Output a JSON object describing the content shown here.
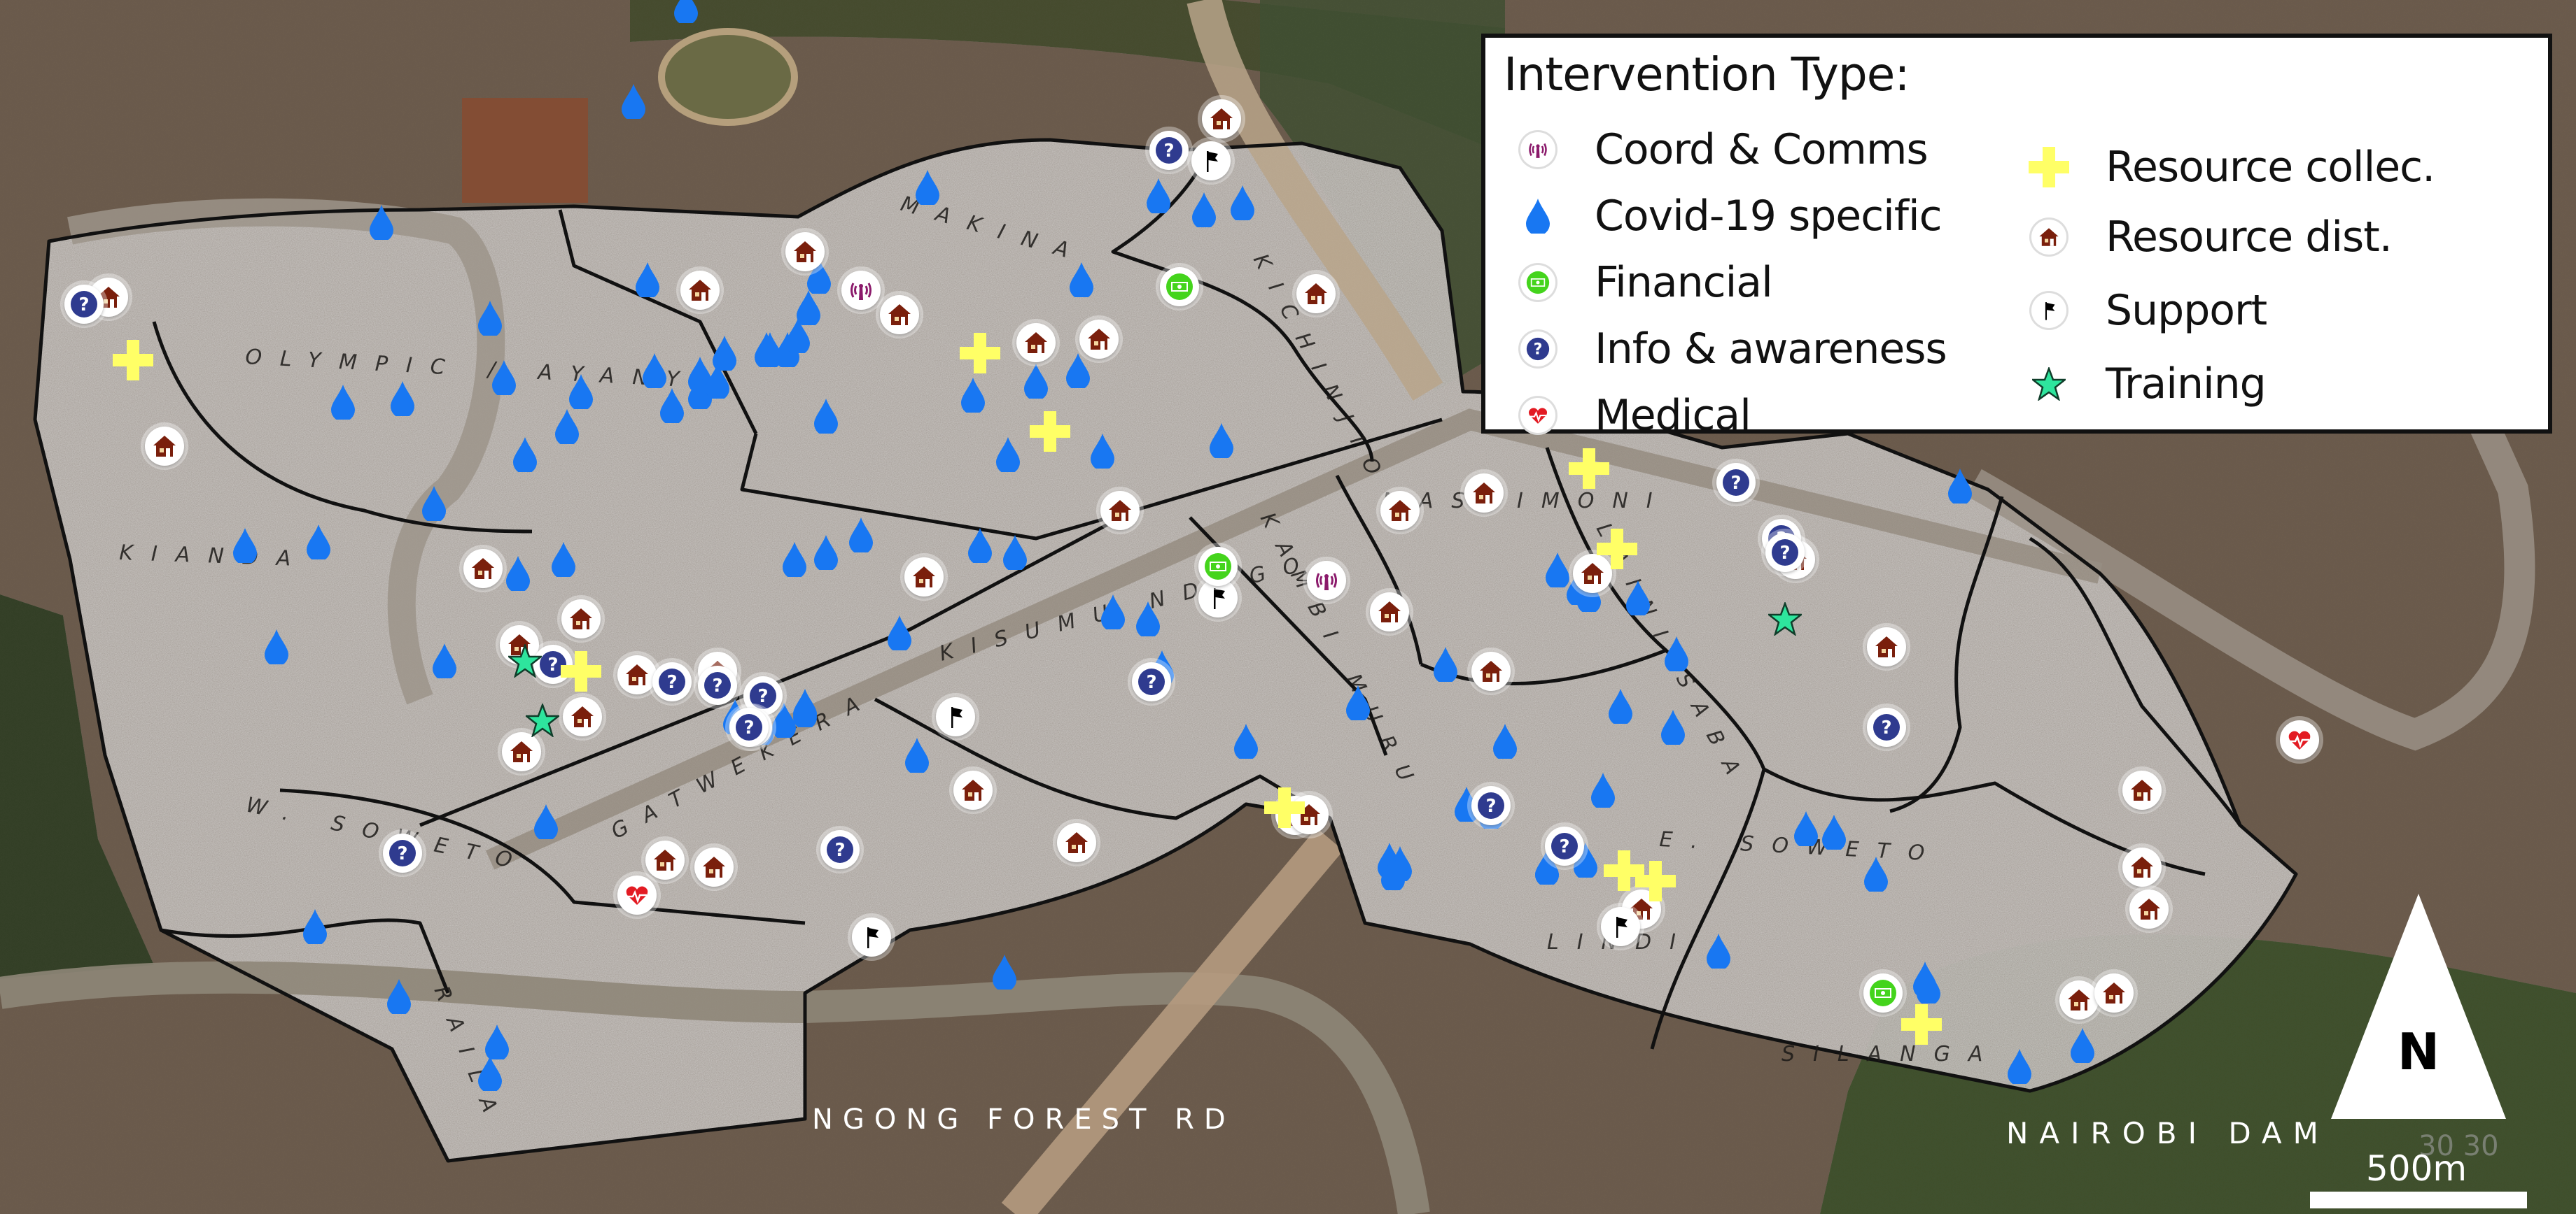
{
  "map": {
    "title": "Intervention Type:",
    "village_labels": [
      {
        "name": "olympic-ayany",
        "text": "OLYMPIC / AYANY"
      },
      {
        "name": "kianda",
        "text": "KIANDA"
      },
      {
        "name": "makina",
        "text": "MAKINA"
      },
      {
        "name": "kichinjio",
        "text": "KICHINJIO"
      },
      {
        "name": "mashimoni",
        "text": "MASHIMONI"
      },
      {
        "name": "kambi-muru",
        "text": "KAMBI MURU"
      },
      {
        "name": "kisumu-ndogo",
        "text": "KISUMU NDOGO"
      },
      {
        "name": "gatwekera",
        "text": "GATWEKERA"
      },
      {
        "name": "w-soweto",
        "text": "W. SOWETO"
      },
      {
        "name": "raila",
        "text": "RAILA"
      },
      {
        "name": "laini-saba",
        "text": "LAINI SABA"
      },
      {
        "name": "lindi",
        "text": "LINDI"
      },
      {
        "name": "silanga",
        "text": "SILANGA"
      },
      {
        "name": "e-soweto",
        "text": "E. SOWETO"
      }
    ],
    "road_label": "NGONG FOREST RD",
    "place_label": "NAIROBI DAM",
    "north_label": "N",
    "scale_label": "500m",
    "faint_watermark": "30 30"
  },
  "legend": {
    "title": "Intervention Type:",
    "items": [
      {
        "key": "coord",
        "label": "Coord & Comms",
        "icon": "broadcast-tower-icon",
        "color": "#8b1a6b"
      },
      {
        "key": "covid",
        "label": "Covid-19 specific",
        "icon": "water-drop-icon",
        "color": "#1877f2"
      },
      {
        "key": "financial",
        "label": "Financial",
        "icon": "banknote-icon",
        "color": "#44d41c"
      },
      {
        "key": "info",
        "label": "Info & awareness",
        "icon": "question-mark-icon",
        "color": "#2f3b8f"
      },
      {
        "key": "medical",
        "label": "Medical",
        "icon": "heartbeat-icon",
        "color": "#e31b23"
      },
      {
        "key": "rcollect",
        "label": "Resource collec.",
        "icon": "plus-cross-icon",
        "color": "#ffff66"
      },
      {
        "key": "rdist",
        "label": "Resource dist.",
        "icon": "house-icon",
        "color": "#7a1f0c"
      },
      {
        "key": "support",
        "label": "Support",
        "icon": "flag-icon",
        "color": "#000000"
      },
      {
        "key": "training",
        "label": "Training",
        "icon": "star-icon",
        "color": "#2ee59d"
      }
    ]
  },
  "markers": {
    "covid": [
      [
        980,
        8
      ],
      [
        905,
        145
      ],
      [
        545,
        318
      ],
      [
        925,
        400
      ],
      [
        700,
        455
      ],
      [
        935,
        530
      ],
      [
        1000,
        535
      ],
      [
        1035,
        505
      ],
      [
        1100,
        500
      ],
      [
        1125,
        500
      ],
      [
        1140,
        480
      ],
      [
        1170,
        395
      ],
      [
        1155,
        440
      ],
      [
        1000,
        560
      ],
      [
        1025,
        545
      ],
      [
        490,
        575
      ],
      [
        720,
        540
      ],
      [
        830,
        560
      ],
      [
        750,
        650
      ],
      [
        810,
        610
      ],
      [
        960,
        580
      ],
      [
        1180,
        595
      ],
      [
        1325,
        268
      ],
      [
        1655,
        280
      ],
      [
        1720,
        300
      ],
      [
        1775,
        290
      ],
      [
        1545,
        400
      ],
      [
        1575,
        645
      ],
      [
        1480,
        545
      ],
      [
        1390,
        565
      ],
      [
        1745,
        630
      ],
      [
        1180,
        790
      ],
      [
        1135,
        800
      ],
      [
        1230,
        765
      ],
      [
        620,
        720
      ],
      [
        575,
        570
      ],
      [
        350,
        780
      ],
      [
        455,
        775
      ],
      [
        740,
        820
      ],
      [
        805,
        800
      ],
      [
        635,
        945
      ],
      [
        395,
        925
      ],
      [
        450,
        1325
      ],
      [
        1285,
        905
      ],
      [
        1400,
        780
      ],
      [
        1450,
        790
      ],
      [
        1590,
        875
      ],
      [
        1640,
        885
      ],
      [
        1660,
        955
      ],
      [
        1050,
        1025
      ],
      [
        1120,
        1030
      ],
      [
        1150,
        1015
      ],
      [
        1310,
        1080
      ],
      [
        1780,
        1060
      ],
      [
        1940,
        1005
      ],
      [
        2065,
        950
      ],
      [
        2225,
        815
      ],
      [
        2270,
        850
      ],
      [
        2340,
        855
      ],
      [
        2315,
        1010
      ],
      [
        2395,
        935
      ],
      [
        2390,
        1040
      ],
      [
        2290,
        1130
      ],
      [
        2130,
        1160
      ],
      [
        2210,
        1240
      ],
      [
        2265,
        1230
      ],
      [
        2210,
        1240
      ],
      [
        1985,
        1230
      ],
      [
        2455,
        1360
      ],
      [
        2580,
        1185
      ],
      [
        2620,
        1190
      ],
      [
        2680,
        1250
      ],
      [
        2755,
        1410
      ],
      [
        2975,
        1495
      ],
      [
        2885,
        1525
      ],
      [
        2800,
        695
      ],
      [
        2255,
        840
      ],
      [
        1150,
        1010
      ],
      [
        1088,
        1040
      ],
      [
        780,
        1175
      ],
      [
        570,
        1425
      ],
      [
        710,
        1490
      ],
      [
        700,
        1535
      ],
      [
        1435,
        1390
      ],
      [
        2750,
        1400
      ],
      [
        2000,
        1235
      ],
      [
        1990,
        1248
      ],
      [
        2095,
        1150
      ],
      [
        2150,
        1060
      ],
      [
        1440,
        650
      ],
      [
        1095,
        500
      ],
      [
        1540,
        530
      ]
    ],
    "rdist": [
      [
        1745,
        170
      ],
      [
        1150,
        360
      ],
      [
        1000,
        415
      ],
      [
        1285,
        450
      ],
      [
        1480,
        490
      ],
      [
        1570,
        485
      ],
      [
        1880,
        420
      ],
      [
        235,
        638
      ],
      [
        155,
        425
      ],
      [
        1600,
        730
      ],
      [
        690,
        813
      ],
      [
        830,
        885
      ],
      [
        742,
        922
      ],
      [
        910,
        965
      ],
      [
        1025,
        960
      ],
      [
        832,
        1025
      ],
      [
        745,
        1075
      ],
      [
        1320,
        825
      ],
      [
        2120,
        705
      ],
      [
        2000,
        730
      ],
      [
        1985,
        875
      ],
      [
        2275,
        820
      ],
      [
        2565,
        800
      ],
      [
        2695,
        925
      ],
      [
        3060,
        1130
      ],
      [
        3060,
        1240
      ],
      [
        3070,
        1300
      ],
      [
        2970,
        1430
      ],
      [
        3020,
        1420
      ],
      [
        950,
        1230
      ],
      [
        1020,
        1240
      ],
      [
        1390,
        1130
      ],
      [
        1538,
        1205
      ],
      [
        1850,
        1166
      ],
      [
        1870,
        1165
      ],
      [
        2345,
        1300
      ],
      [
        2130,
        960
      ]
    ],
    "info": [
      [
        120,
        435
      ],
      [
        1670,
        215
      ],
      [
        2480,
        690
      ],
      [
        2545,
        770
      ],
      [
        1645,
        975
      ],
      [
        790,
        950
      ],
      [
        960,
        975
      ],
      [
        1025,
        980
      ],
      [
        1090,
        995
      ],
      [
        1075,
        1040
      ],
      [
        575,
        1220
      ],
      [
        1200,
        1215
      ],
      [
        2130,
        1152
      ],
      [
        2235,
        1210
      ],
      [
        2695,
        1040
      ],
      [
        2550,
        790
      ],
      [
        1070,
        1040
      ]
    ],
    "support": [
      [
        1730,
        230
      ],
      [
        1740,
        855
      ],
      [
        1365,
        1025
      ],
      [
        1245,
        1340
      ],
      [
        2315,
        1325
      ]
    ],
    "financial": [
      [
        1685,
        410
      ],
      [
        1740,
        810
      ],
      [
        2690,
        1420
      ]
    ],
    "coord": [
      [
        1230,
        415
      ],
      [
        1895,
        830
      ]
    ],
    "medical": [
      [
        910,
        1280
      ],
      [
        3285,
        1058
      ]
    ],
    "rcollect": [
      [
        190,
        515
      ],
      [
        1400,
        505
      ],
      [
        1500,
        617
      ],
      [
        2270,
        670
      ],
      [
        2310,
        785
      ],
      [
        830,
        960
      ],
      [
        1835,
        1155
      ],
      [
        2320,
        1245
      ],
      [
        2365,
        1260
      ],
      [
        2745,
        1465
      ]
    ],
    "training": [
      [
        750,
        945
      ],
      [
        775,
        1030
      ],
      [
        2550,
        885
      ]
    ]
  }
}
